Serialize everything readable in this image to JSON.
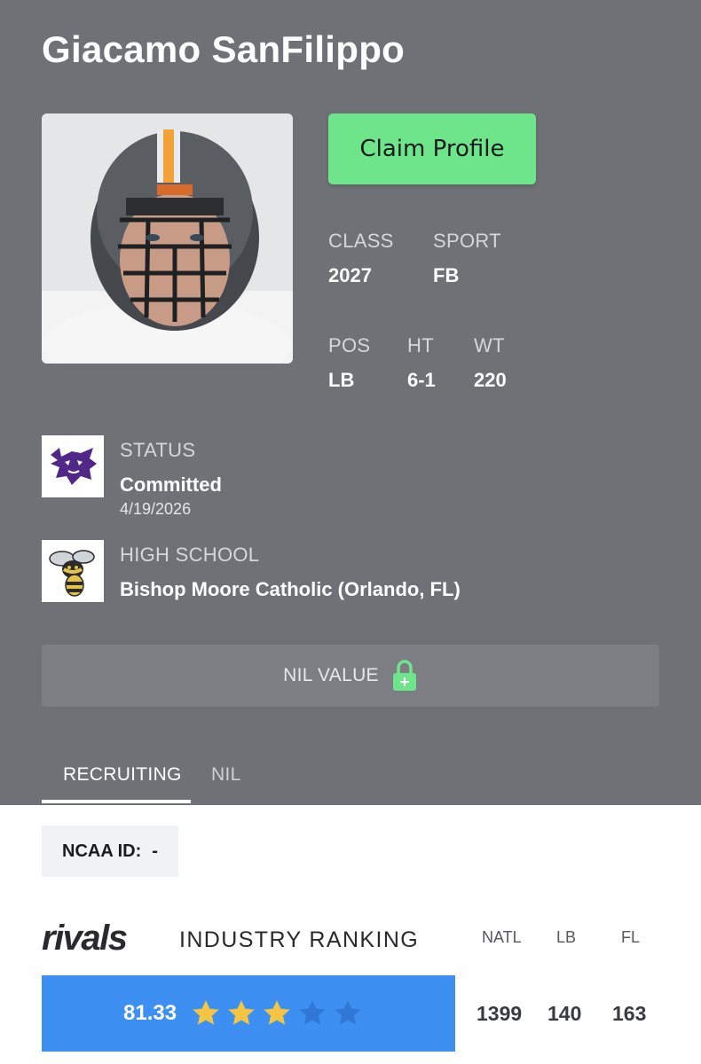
{
  "profile": {
    "name": "Giacamo SanFilippo",
    "claim_label": "Claim Profile"
  },
  "stats": {
    "class_label": "CLASS",
    "class_value": "2027",
    "sport_label": "SPORT",
    "sport_value": "FB",
    "pos_label": "POS",
    "pos_value": "LB",
    "ht_label": "HT",
    "ht_value": "6-1",
    "wt_label": "WT",
    "wt_value": "220"
  },
  "status": {
    "label": "STATUS",
    "value": "Committed",
    "date": "4/19/2026",
    "logo_icon": "kansas-state-wildcat-icon",
    "logo_color": "#512888"
  },
  "high_school": {
    "label": "HIGH SCHOOL",
    "value": "Bishop Moore Catholic (Orlando, FL)",
    "logo_icon": "hornet-mascot-icon"
  },
  "nil": {
    "label": "NIL VALUE",
    "icon": "lock-plus-icon",
    "icon_color": "#6ee58a"
  },
  "tabs": [
    {
      "label": "RECRUITING",
      "active": true
    },
    {
      "label": "NIL",
      "active": false
    }
  ],
  "ncaa": {
    "label": "NCAA ID:",
    "value": "-"
  },
  "ranking": {
    "brand": "rivals",
    "title": "INDUSTRY RANKING",
    "score": "81.33",
    "stars_filled": 3,
    "stars_total": 5,
    "star_color": "#f4c542",
    "columns": [
      {
        "label": "NATL",
        "value": "1399"
      },
      {
        "label": "LB",
        "value": "140"
      },
      {
        "label": "FL",
        "value": "163"
      }
    ]
  },
  "colors": {
    "hero_bg": "#6f7177",
    "claim_green": "#6ee58a",
    "score_blue": "#3d8ff2"
  }
}
